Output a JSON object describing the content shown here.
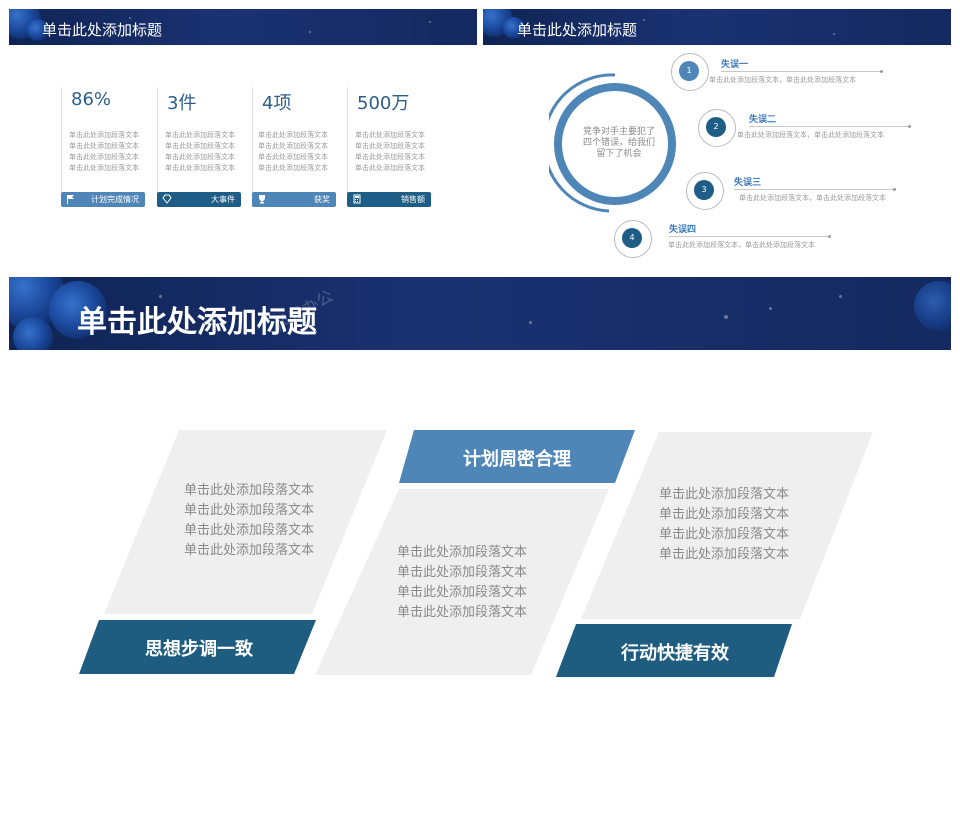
{
  "slide1": {
    "title": "单击此处添加标题",
    "kpis": [
      {
        "value": "86%",
        "lines": [
          "单击此处添加段落文本",
          "单击此处添加段落文本",
          "单击此处添加段落文本",
          "单击此处添加段落文本"
        ],
        "label": "计划完成情况",
        "icon": "flag-icon",
        "color": "#4f86b8"
      },
      {
        "value": "3件",
        "lines": [
          "单击此处添加段落文本",
          "单击此处添加段落文本",
          "单击此处添加段落文本",
          "单击此处添加段落文本"
        ],
        "label": "大事件",
        "icon": "diamond-icon",
        "color": "#1e5d86"
      },
      {
        "value": "4项",
        "lines": [
          "单击此处添加段落文本",
          "单击此处添加段落文本",
          "单击此处添加段落文本",
          "单击此处添加段落文本"
        ],
        "label": "获奖",
        "icon": "trophy-icon",
        "color": "#4f86b8"
      },
      {
        "value": "500万",
        "lines": [
          "单击此处添加段落文本",
          "单击此处添加段落文本",
          "单击此处添加段落文本",
          "单击此处添加段落文本"
        ],
        "label": "销售额",
        "icon": "calculator-icon",
        "color": "#1e5d86"
      }
    ]
  },
  "slide2": {
    "title": "单击此处添加标题",
    "center_text": [
      "竞争对手主要犯了",
      "四个错误，给我们",
      "留下了机会"
    ],
    "mistakes": [
      {
        "num": "1",
        "title": "失误一",
        "desc": "单击此处添加段落文本，单击此处添加段落文本",
        "color": "#4f86b8"
      },
      {
        "num": "2",
        "title": "失误二",
        "desc": "单击此处添加段落文本，单击此处添加段落文本",
        "color": "#1e5d86"
      },
      {
        "num": "3",
        "title": "失误三",
        "desc": "单击此处添加段落文本，单击此处添加段落文本",
        "color": "#1e5d86"
      },
      {
        "num": "4",
        "title": "失误四",
        "desc": "单击此处添加段落文本，单击此处添加段落文本",
        "color": "#1e5d86"
      }
    ]
  },
  "slide3": {
    "title": "单击此处添加标题",
    "watermark": "风云办公",
    "panels": [
      {
        "tag": "思想步调一致",
        "lines": [
          "单击此处添加段落文本",
          "单击此处添加段落文本",
          "单击此处添加段落文本",
          "单击此处添加段落文本"
        ],
        "tag_color": "#1e5d80"
      },
      {
        "tag": "计划周密合理",
        "lines": [
          "单击此处添加段落文本",
          "单击此处添加段落文本",
          "单击此处添加段落文本",
          "单击此处添加段落文本"
        ],
        "tag_color": "#4f86b8"
      },
      {
        "tag": "行动快捷有效",
        "lines": [
          "单击此处添加段落文本",
          "单击此处添加段落文本",
          "单击此处添加段落文本",
          "单击此处添加段落文本"
        ],
        "tag_color": "#1e5d80"
      }
    ]
  }
}
